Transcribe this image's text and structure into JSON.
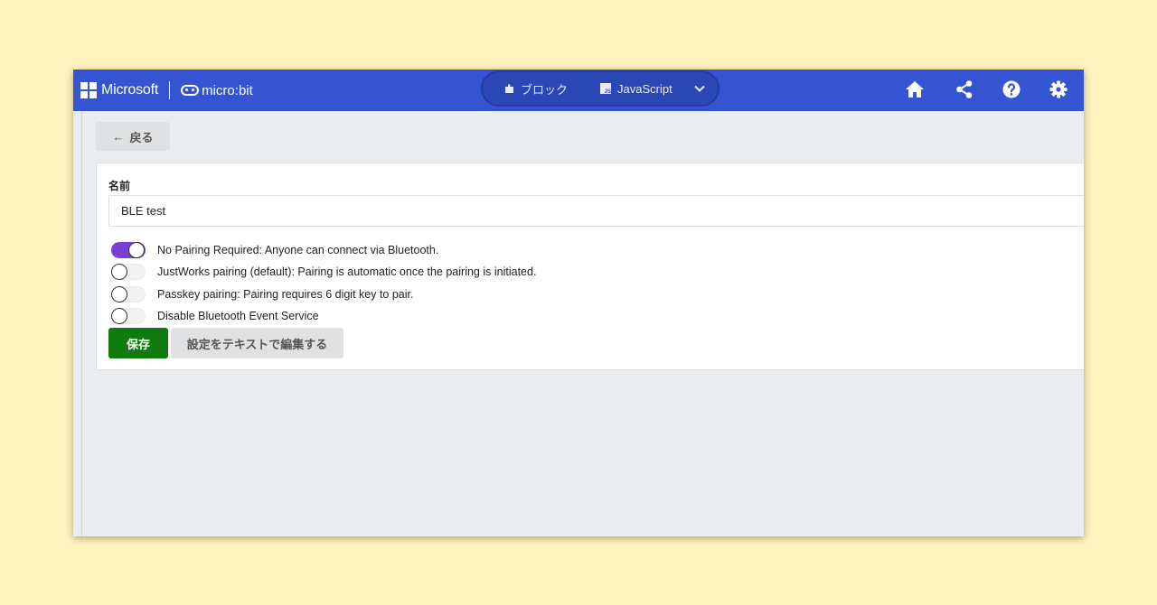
{
  "header": {
    "microsoft_label": "Microsoft",
    "microbit_label": "micro:bit",
    "mode_blocks_label": "ブロック",
    "mode_js_label": "JavaScript",
    "brand_color": "#3454d1"
  },
  "toolbar_icons": [
    "home-icon",
    "share-icon",
    "help-icon",
    "gear-icon"
  ],
  "back_button": {
    "label": "戻る"
  },
  "form": {
    "name_label": "名前",
    "name_value": "BLE test",
    "options": [
      {
        "label": "No Pairing Required: Anyone can connect via Bluetooth.",
        "enabled": true
      },
      {
        "label": "JustWorks pairing (default): Pairing is automatic once the pairing is initiated.",
        "enabled": false
      },
      {
        "label": "Passkey pairing: Pairing requires 6 digit key to pair.",
        "enabled": false
      },
      {
        "label": "Disable Bluetooth Event Service",
        "enabled": false
      }
    ],
    "save_label": "保存",
    "edit_text_label": "設定をテキストで編集する"
  },
  "colors": {
    "toggle_on": "#7b3fd6",
    "save_button": "#107c10"
  }
}
